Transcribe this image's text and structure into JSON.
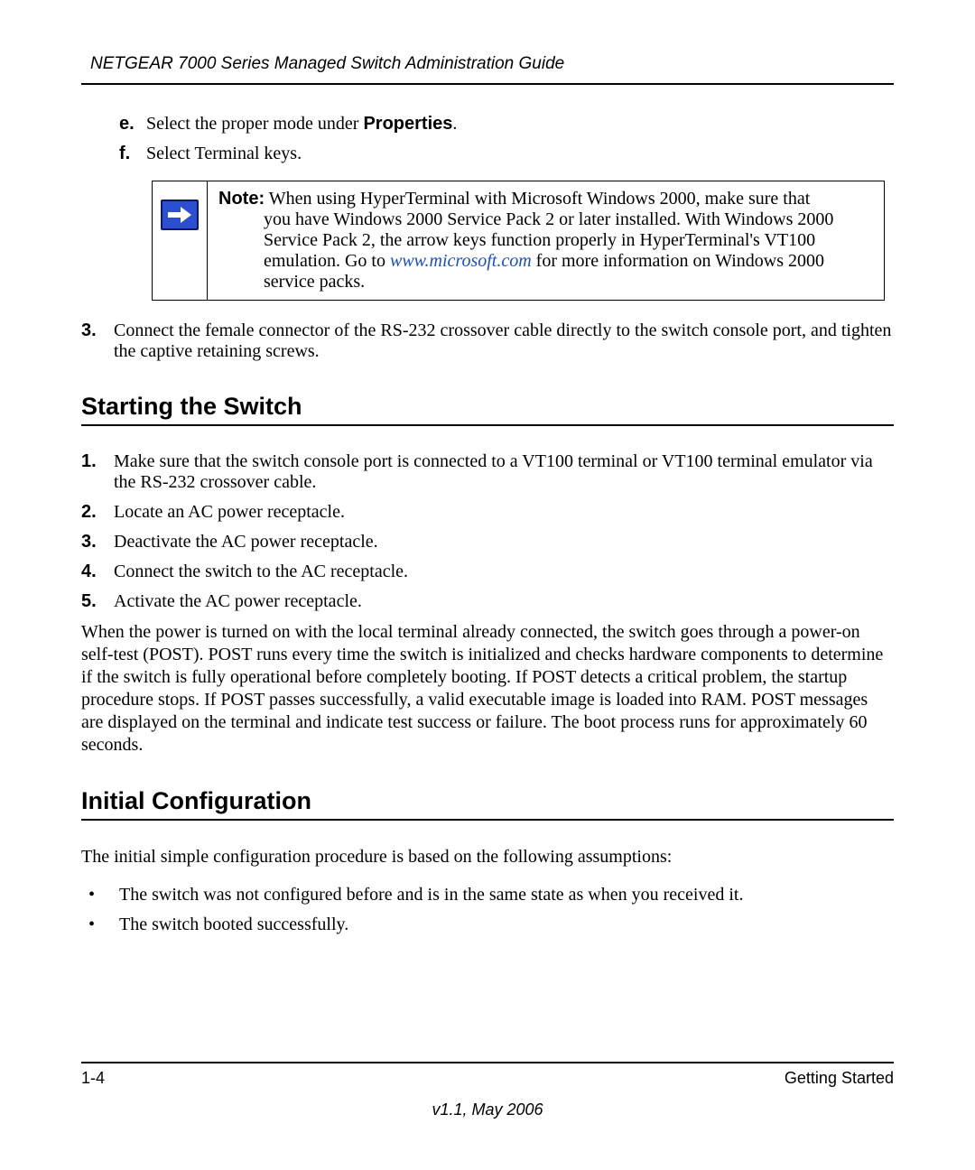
{
  "header": "NETGEAR 7000  Series Managed Switch Administration Guide",
  "sublist": {
    "e": {
      "marker": "e.",
      "pre": "Select the proper mode under ",
      "bold": "Properties",
      "post": "."
    },
    "f": {
      "marker": "f.",
      "text": "Select Terminal keys."
    }
  },
  "note": {
    "label": "Note:",
    "line1_rest": " When using HyperTerminal with Microsoft Windows 2000, make sure that",
    "line2": "you have Windows 2000 Service Pack 2 or later installed. With Windows 2000 Service Pack 2, the arrow keys function properly in HyperTerminal's VT100 emulation. Go to ",
    "link": "www.microsoft.com",
    "line3": " for more information on Windows 2000 service packs."
  },
  "step3": {
    "marker": "3.",
    "text": "Connect the female connector of the RS-232 crossover cable directly to the switch console port, and tighten the captive retaining screws."
  },
  "section1": {
    "title": "Starting the Switch",
    "items": [
      {
        "marker": "1.",
        "text": "Make sure that the switch console port is connected to a VT100 terminal or VT100 terminal emulator via the RS-232 crossover cable."
      },
      {
        "marker": "2.",
        "text": "Locate an AC power receptacle."
      },
      {
        "marker": "3.",
        "text": "Deactivate the AC power receptacle."
      },
      {
        "marker": "4.",
        "text": "Connect the switch to the AC receptacle."
      },
      {
        "marker": "5.",
        "text": "Activate the AC power receptacle."
      }
    ],
    "para": "When the power is turned on with the local terminal already connected, the switch goes through a power-on self-test (POST). POST runs every time the switch is initialized and checks hardware components to determine if the switch is fully operational before completely booting. If POST detects a critical problem, the startup procedure stops. If POST passes successfully, a valid executable image is loaded into RAM. POST messages are displayed on the terminal and indicate test success or failure. The boot process runs for approximately 60 seconds."
  },
  "section2": {
    "title": "Initial Configuration",
    "intro": "The initial simple configuration procedure is based on the following assumptions:",
    "bullets": [
      "The switch was not configured before and is in the same state as when you received it.",
      "The switch booted successfully."
    ]
  },
  "footer": {
    "left": "1-4",
    "right": "Getting Started",
    "center": "v1.1, May 2006"
  }
}
